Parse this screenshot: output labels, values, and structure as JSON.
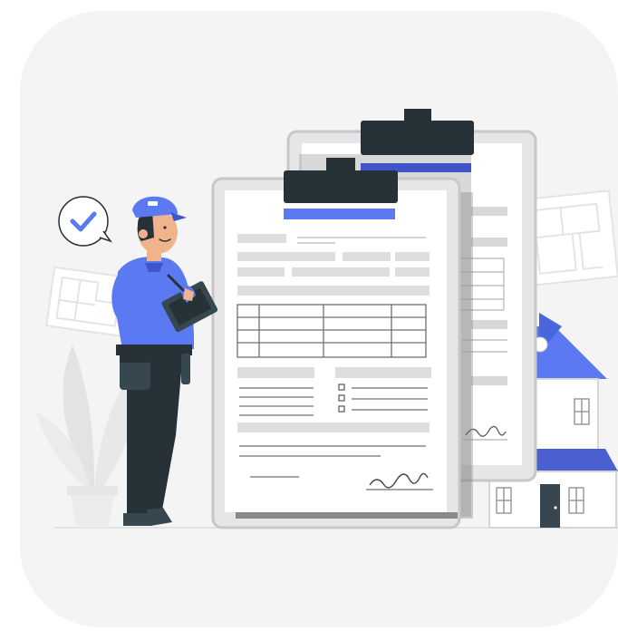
{
  "scene": {
    "subject": "inspector-with-clipboard-and-documents",
    "icons": [
      "checkmark-speech-bubble-icon",
      "house-icon",
      "plant-icon",
      "blueprint-icon",
      "signature-icon"
    ],
    "colors": {
      "background_card": "#f4f4f4",
      "accent_blue": "#5b79f0",
      "accent_blue_dark": "#3f55c9",
      "ink_dark": "#263238",
      "paper": "#ffffff",
      "paper_gray": "#c7c7c7",
      "line_gray": "#d8d8d8",
      "skin": "#f0b48c"
    }
  }
}
